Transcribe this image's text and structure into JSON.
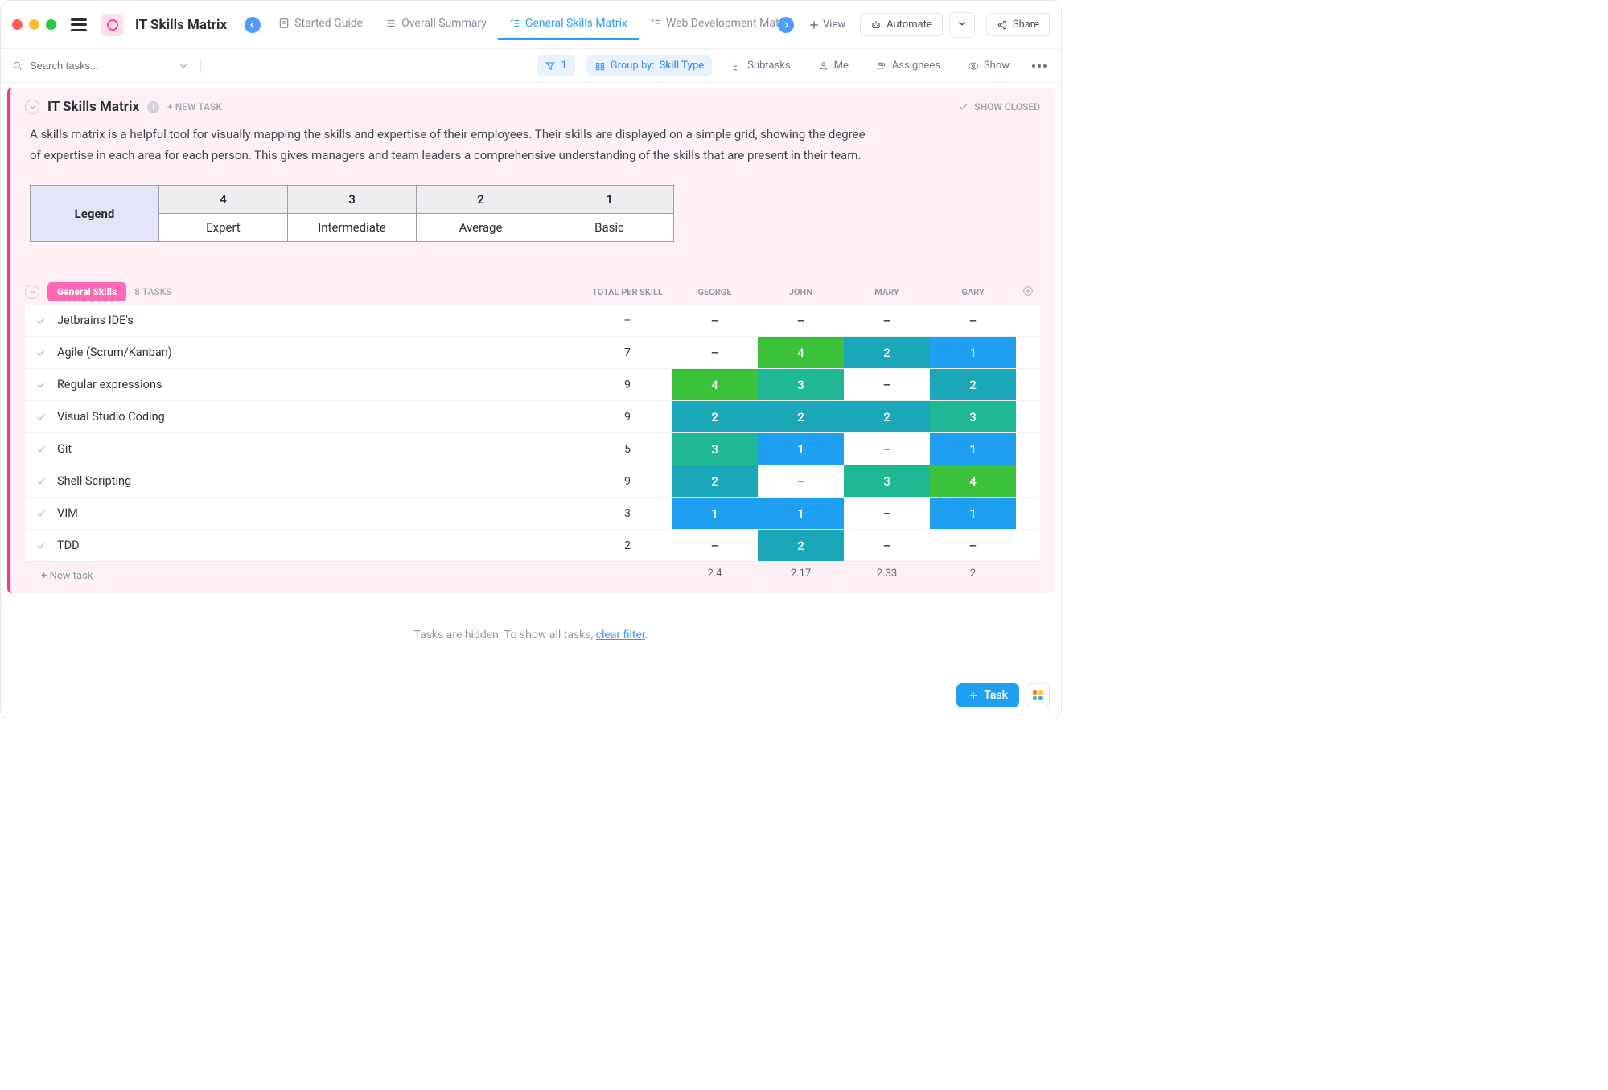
{
  "header": {
    "title": "IT Skills Matrix",
    "tabs": [
      {
        "label": "Started Guide"
      },
      {
        "label": "Overall Summary"
      },
      {
        "label": "General Skills Matrix"
      },
      {
        "label": "Web Development Matrix"
      }
    ],
    "view_btn": "View",
    "automate_btn": "Automate",
    "share_btn": "Share"
  },
  "toolbar": {
    "search_placeholder": "Search tasks...",
    "filter_count": "1",
    "group_by_label": "Group by:",
    "group_by_value": "Skill Type",
    "subtasks": "Subtasks",
    "me": "Me",
    "assignees": "Assignees",
    "show": "Show"
  },
  "panel": {
    "title": "IT Skills Matrix",
    "new_task": "+ NEW TASK",
    "show_closed": "SHOW CLOSED",
    "description": "A skills matrix is a helpful tool for visually mapping the skills and expertise of their employees. Their skills are displayed on a simple grid, showing the degree of expertise in each area for each person. This gives managers and team leaders a comprehensive understanding of the skills that are present in their team."
  },
  "legend": {
    "header": "Legend",
    "levels": [
      {
        "num": "4",
        "label": "Expert"
      },
      {
        "num": "3",
        "label": "Intermediate"
      },
      {
        "num": "2",
        "label": "Average"
      },
      {
        "num": "1",
        "label": "Basic"
      }
    ]
  },
  "group": {
    "name": "General Skills",
    "count": "8 TASKS",
    "columns": {
      "total": "TOTAL PER SKILL",
      "people": [
        "GEORGE",
        "JOHN",
        "MARY",
        "GARY"
      ]
    }
  },
  "rows": [
    {
      "name": "Jetbrains IDE's",
      "total": "–",
      "cells": [
        "–",
        "–",
        "–",
        "–"
      ]
    },
    {
      "name": "Agile (Scrum/Kanban)",
      "total": "7",
      "cells": [
        "–",
        "4",
        "2",
        "1"
      ]
    },
    {
      "name": "Regular expressions",
      "total": "9",
      "cells": [
        "4",
        "3",
        "–",
        "2"
      ]
    },
    {
      "name": "Visual Studio Coding",
      "total": "9",
      "cells": [
        "2",
        "2",
        "2",
        "3"
      ]
    },
    {
      "name": "Git",
      "total": "5",
      "cells": [
        "3",
        "1",
        "–",
        "1"
      ]
    },
    {
      "name": "Shell Scripting",
      "total": "9",
      "cells": [
        "2",
        "–",
        "3",
        "4"
      ]
    },
    {
      "name": "VIM",
      "total": "3",
      "cells": [
        "1",
        "1",
        "–",
        "1"
      ]
    },
    {
      "name": "TDD",
      "total": "2",
      "cells": [
        "–",
        "2",
        "–",
        "–"
      ]
    }
  ],
  "averages": [
    "2.4",
    "2.17",
    "2.33",
    "2"
  ],
  "new_task_row": "+ New task",
  "hidden": {
    "text_a": "Tasks are hidden. To show all tasks, ",
    "link": "clear filter",
    "text_b": "."
  },
  "bottom": {
    "task_btn": "Task"
  },
  "colors": {
    "accent_pink": "#ff2e8a",
    "level4": "#3cc13b",
    "level3": "#1fb895",
    "level2": "#1aa8b8",
    "level1": "#1e9ff2"
  }
}
